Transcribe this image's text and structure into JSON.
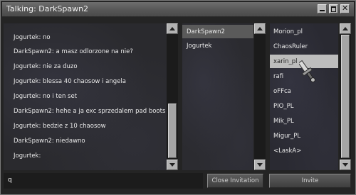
{
  "window": {
    "title": "Talking: DarkSpawn2"
  },
  "chat": {
    "messages": [
      "Jogurtek:       no",
      "DarkSpawn2: a masz odlorzone na nie?",
      "Jogurtek: nie za duzo",
      "Jogurtek: blessa 40 chaosow i angela",
      "Jogurtek: no i ten set",
      "DarkSpawn2: hehe a ja exc sprzedalem pad boots",
      "Jogurtek: bedzie z 10 chaosow",
      "DarkSpawn2: niedawno",
      "Jogurtek:"
    ]
  },
  "members": {
    "items": [
      "DarkSpawn2",
      "Jogurtek"
    ],
    "selected_index": 0
  },
  "users": {
    "items": [
      "Morion_pl",
      "ChaosRuler",
      "xarin_pl",
      "rafi",
      "oFFca",
      "PIO_PL",
      "Mik_PL",
      "Migur_PL",
      "<LaskA>"
    ],
    "selected_index": 2
  },
  "input": {
    "value": "q"
  },
  "buttons": {
    "close_invitation": "Close Invitation",
    "invite": "Invite"
  },
  "icons": {
    "cursor": "sword-cursor-icon"
  }
}
